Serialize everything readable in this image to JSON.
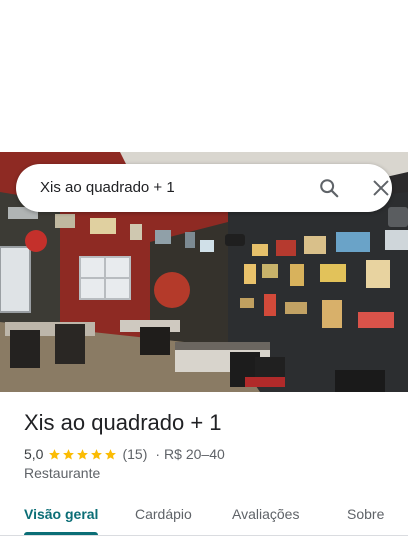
{
  "search": {
    "query": "Xis ao quadrado + 1"
  },
  "place": {
    "name": "Xis ao quadrado + 1",
    "rating": "5,0",
    "stars": 5,
    "reviews": "(15)",
    "separator": "·",
    "price": "R$ 20–40",
    "category": "Restaurante"
  },
  "tabs": [
    {
      "label": "Visão geral",
      "active": true
    },
    {
      "label": "Cardápio",
      "active": false
    },
    {
      "label": "Avaliações",
      "active": false
    },
    {
      "label": "Sobre",
      "active": false
    }
  ],
  "icons": {
    "search": "search-icon",
    "close": "close-icon",
    "star": "star-icon"
  },
  "colors": {
    "accent": "#0b6e76",
    "star": "#fbbc04",
    "title": "#202124",
    "secondary": "#5f6368"
  }
}
